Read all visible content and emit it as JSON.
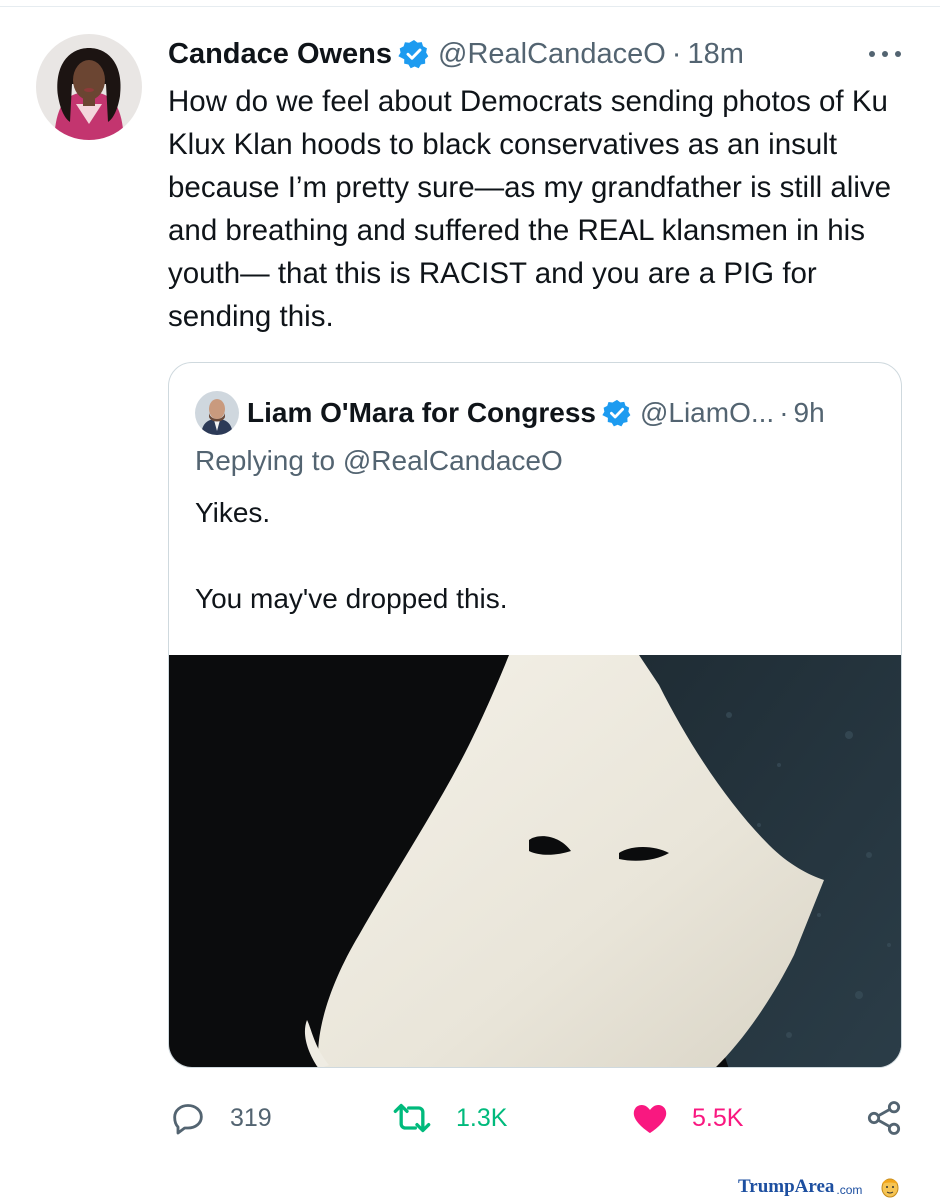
{
  "tweet": {
    "author_name": "Candace Owens",
    "author_handle": "@RealCandaceO",
    "separator": "·",
    "time": "18m",
    "more_icon": "more-horizontal-icon",
    "verified_icon": "verified-badge-icon",
    "text": "How do we feel about Democrats sending photos of Ku Klux Klan hoods to black conservatives as an insult because I’m pretty sure—as my grandfather is still alive and breathing and suffered the REAL klansmen in his youth— that this is RACIST and you are a PIG for sending this."
  },
  "quoted_tweet": {
    "author_name": "Liam O'Mara for Congress",
    "author_handle": "@LiamO...",
    "separator": "·",
    "time": "9h",
    "replying_prefix": "Replying to",
    "replying_to": "@RealCandaceO",
    "text_line1": "Yikes.",
    "text_line2": "You may've dropped this."
  },
  "actions": {
    "reply": {
      "icon": "reply-icon",
      "count": "319"
    },
    "retweet": {
      "icon": "retweet-icon",
      "count": "1.3K"
    },
    "like": {
      "icon": "heart-icon",
      "count": "5.5K"
    },
    "share": {
      "icon": "share-icon"
    }
  },
  "watermark": {
    "text_trump": "Trump",
    "text_area": "Area",
    "text_com": ".com"
  },
  "colors": {
    "text": "#0f1419",
    "secondary": "#536471",
    "verified": "#1d9bf0",
    "retweet": "#00ba7c",
    "like": "#f91880",
    "border": "#cfd9de"
  }
}
